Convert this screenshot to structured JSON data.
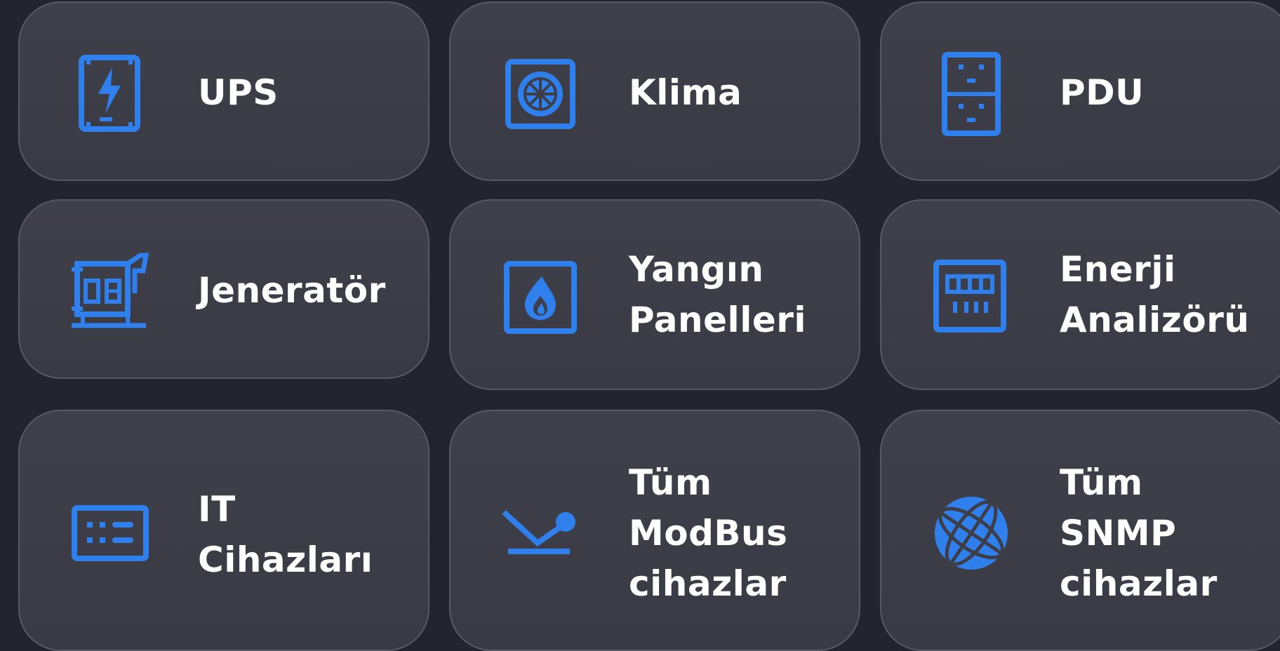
{
  "accent_color": "#2f80ed",
  "background_color": "#23242e",
  "card_color": "#3d3e48",
  "tiles": [
    {
      "icon": "ups-icon",
      "lines": [
        "UPS"
      ]
    },
    {
      "icon": "air-conditioner-icon",
      "lines": [
        "Klima"
      ]
    },
    {
      "icon": "pdu-icon",
      "lines": [
        "PDU"
      ]
    },
    {
      "icon": "generator-icon",
      "lines": [
        "Jeneratör"
      ]
    },
    {
      "icon": "fire-panel-icon",
      "lines": [
        "Yangın",
        "Panelleri"
      ]
    },
    {
      "icon": "energy-analyzer-icon",
      "lines": [
        "Enerji",
        "Analizörü"
      ]
    },
    {
      "icon": "it-device-icon",
      "lines": [
        "IT",
        "Cihazları"
      ]
    },
    {
      "icon": "modbus-icon",
      "lines": [
        "Tüm",
        "ModBus",
        "cihazlar"
      ]
    },
    {
      "icon": "snmp-globe-icon",
      "lines": [
        "Tüm",
        "SNMP",
        "cihazlar"
      ]
    }
  ]
}
